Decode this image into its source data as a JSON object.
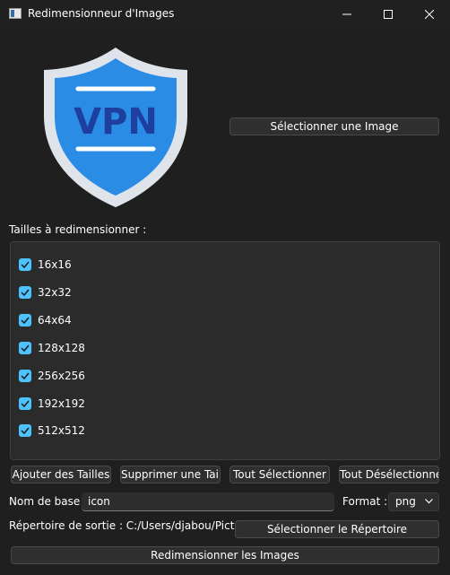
{
  "window": {
    "title": "Redimensionneur d'Images",
    "controls": [
      "minimize-icon",
      "maximize-icon",
      "close-icon"
    ]
  },
  "logo": {
    "text": "VPN",
    "icon": "vpn-shield-logo"
  },
  "select_image_button": "Sélectionner une Image",
  "sizes_label": "Tailles à redimensionner :",
  "sizes": [
    {
      "label": "16x16",
      "checked": true
    },
    {
      "label": "32x32",
      "checked": true
    },
    {
      "label": "64x64",
      "checked": true
    },
    {
      "label": "128x128",
      "checked": true
    },
    {
      "label": "256x256",
      "checked": true
    },
    {
      "label": "192x192",
      "checked": true
    },
    {
      "label": "512x512",
      "checked": true
    }
  ],
  "actions": {
    "add": "Ajouter des Tailles",
    "remove": "Supprimer une Taille",
    "select_all": "Tout Sélectionner",
    "deselect_all": "Tout Désélectionner"
  },
  "base_name": {
    "label": "Nom de base :",
    "value": "icon"
  },
  "format": {
    "label": "Format :",
    "value": "png"
  },
  "output": {
    "label": "Répertoire de sortie : C:/Users/djabou/Pictures",
    "button": "Sélectionner le Répertoire"
  },
  "resize_button": "Redimensionner les Images",
  "colors": {
    "accent": "#4cc2ff",
    "shield_outer": "#dfe3ea",
    "shield_inner": "#2b8ce6",
    "vpn_text": "#1e3f9e"
  }
}
